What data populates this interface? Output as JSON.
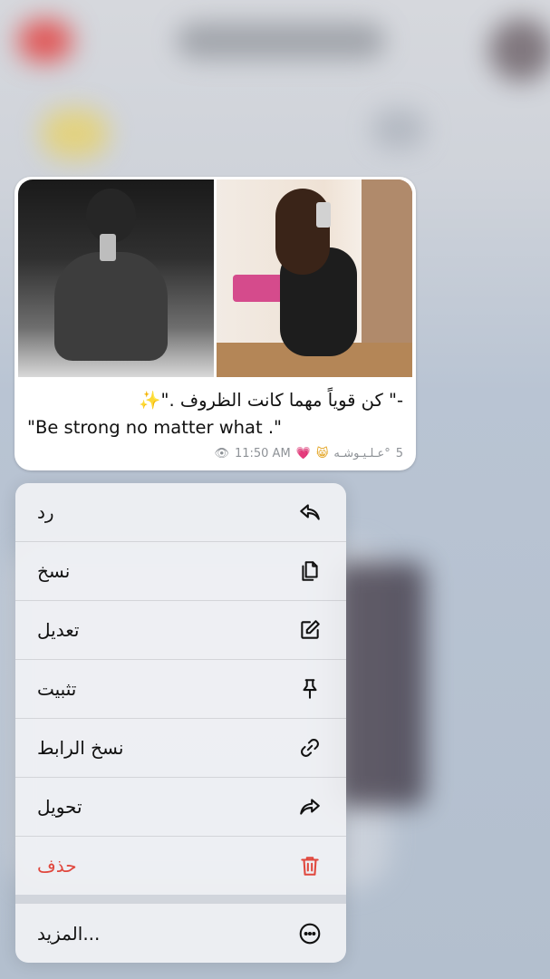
{
  "message": {
    "caption_arabic": "-\" كن قوياً مهما كانت الظروف .\"✨",
    "caption_english": "\"Be strong no matter what .\"",
    "meta": {
      "views": "5",
      "author": "عـلـيـوشـه°",
      "time": "11:50 AM",
      "emoji_cat": "😸",
      "emoji_heart": "💗"
    }
  },
  "context_menu": {
    "items": [
      {
        "label": "رد",
        "icon": "reply-icon"
      },
      {
        "label": "نسخ",
        "icon": "copy-icon"
      },
      {
        "label": "تعديل",
        "icon": "edit-icon"
      },
      {
        "label": "تثبيت",
        "icon": "pin-icon"
      },
      {
        "label": "نسخ الرابط",
        "icon": "link-icon"
      },
      {
        "label": "تحويل",
        "icon": "forward-icon"
      },
      {
        "label": "حذف",
        "icon": "trash-icon",
        "color": "#e0473d"
      }
    ],
    "more": {
      "label": "المزيد...",
      "icon": "more-icon"
    }
  }
}
